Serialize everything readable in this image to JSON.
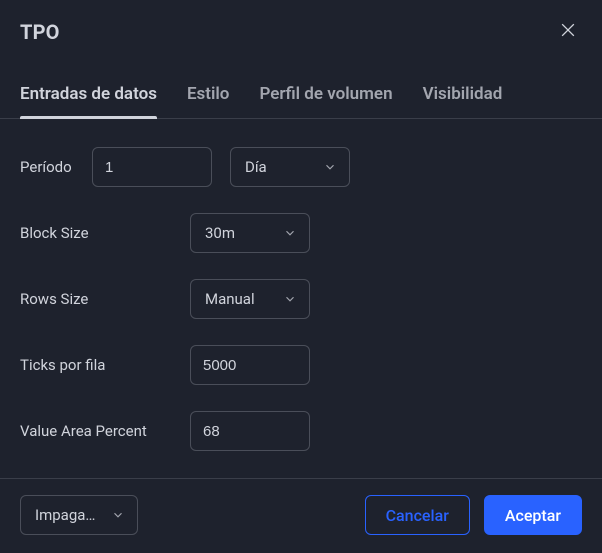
{
  "header": {
    "title": "TPO"
  },
  "tabs": [
    {
      "label": "Entradas de datos",
      "active": true
    },
    {
      "label": "Estilo",
      "active": false
    },
    {
      "label": "Perfil de volumen",
      "active": false
    },
    {
      "label": "Visibilidad",
      "active": false
    }
  ],
  "inputs": {
    "period": {
      "label": "Período",
      "value": "1",
      "unit": "Día"
    },
    "block_size": {
      "label": "Block Size",
      "value": "30m"
    },
    "rows_size": {
      "label": "Rows Size",
      "value": "Manual"
    },
    "ticks_per_row": {
      "label": "Ticks por fila",
      "value": "5000"
    },
    "value_area_percent": {
      "label": "Value Area Percent",
      "value": "68"
    }
  },
  "footer": {
    "defaults_label": "Impagados",
    "cancel_label": "Cancelar",
    "accept_label": "Aceptar"
  },
  "colors": {
    "accent": "#2962ff",
    "bg": "#1e222d",
    "text": "#d1d4dc",
    "border": "#4a4e59"
  }
}
